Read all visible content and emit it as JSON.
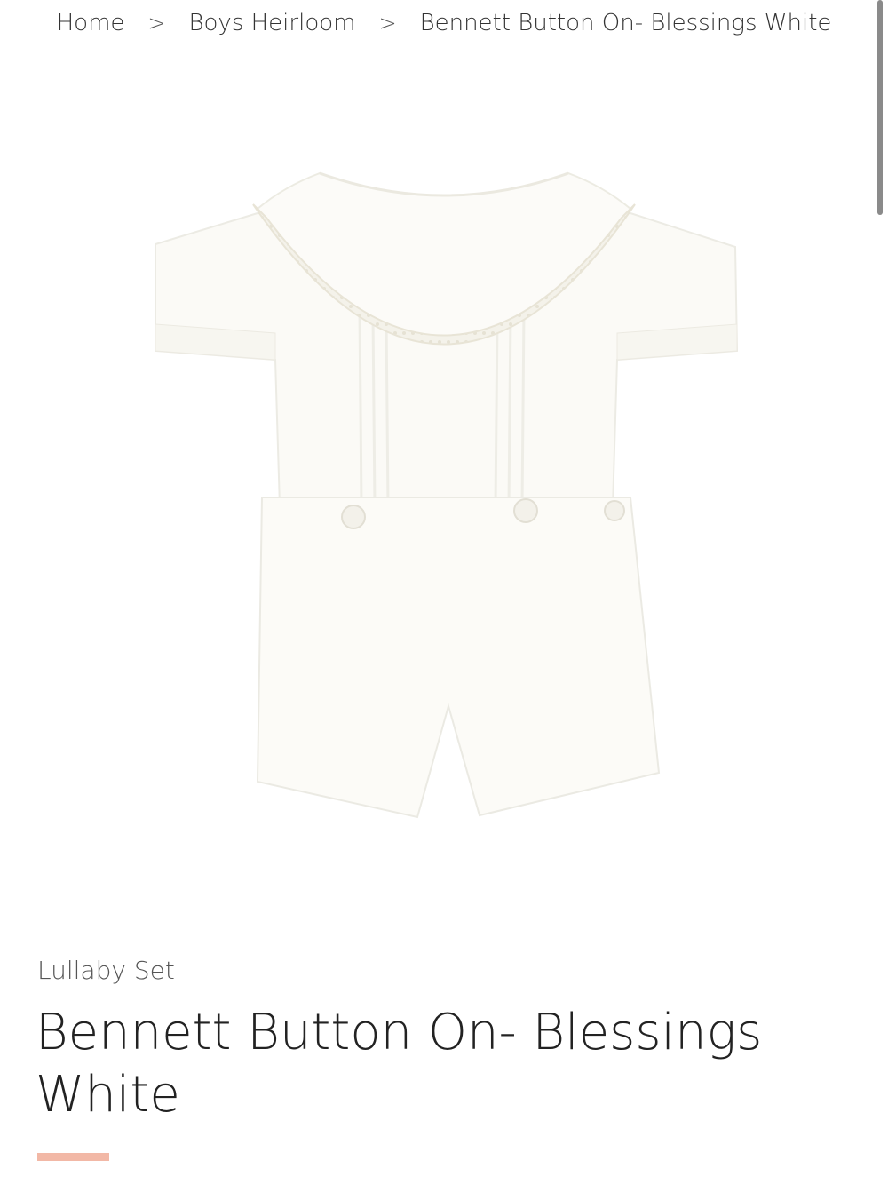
{
  "breadcrumb": {
    "items": [
      {
        "label": "Home"
      },
      {
        "label": "Boys Heirloom"
      },
      {
        "label": "Bennett Button On- Blessings White"
      }
    ],
    "separator": ">"
  },
  "product": {
    "brand": "Lullaby Set",
    "title": "Bennett Button On- Blessings White",
    "image_icon": "product-photo-romper"
  },
  "colors": {
    "accent": "#f2b8a6",
    "garment": "#fbfaf6",
    "lace": "#f1efe6"
  }
}
